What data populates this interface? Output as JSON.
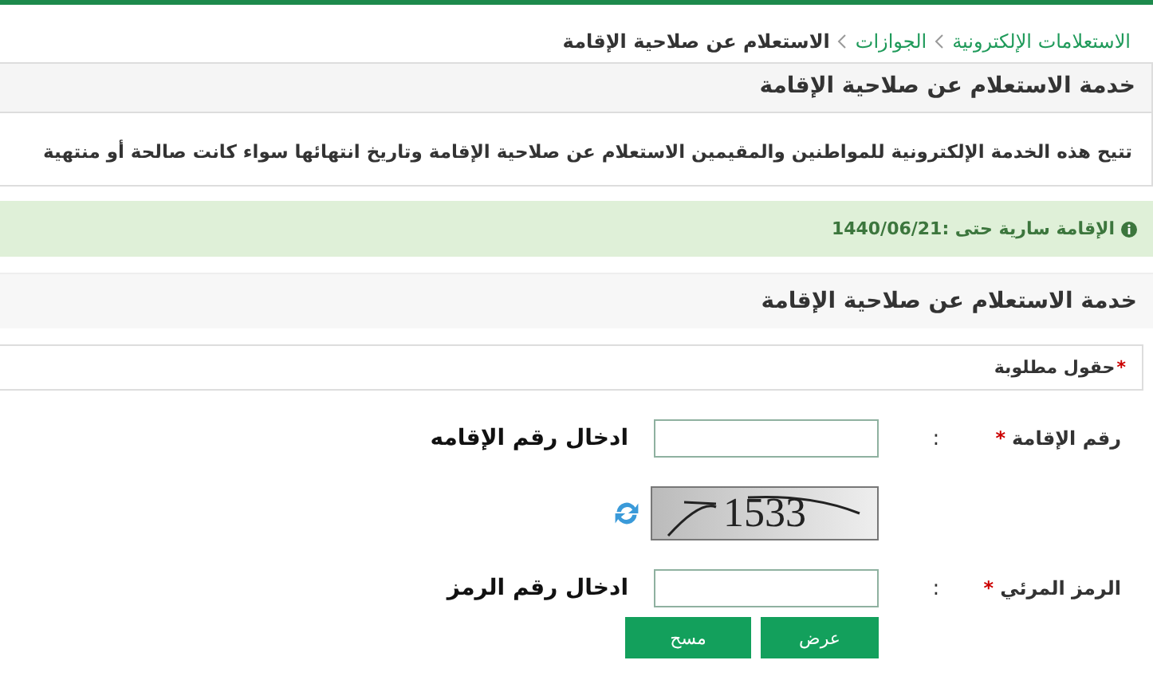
{
  "breadcrumb": [
    {
      "label": "الاستعلامات الإلكترونية",
      "kind": "link"
    },
    {
      "label": "الجوازات",
      "kind": "link"
    },
    {
      "label": "الاستعلام عن صلاحية الإقامة",
      "kind": "current"
    }
  ],
  "panel": {
    "title": "خدمة الاستعلام عن صلاحية الإقامة",
    "description": "تتيح هذه الخدمة الإلكترونية للمواطنين والمقيمين الاستعلام عن صلاحية الإقامة وتاريخ انتهائها سواء كانت صالحة أو منتهية"
  },
  "alert": {
    "text": "الإقامة سارية حتى :1440/06/21"
  },
  "form": {
    "title": "خدمة الاستعلام عن صلاحية الإقامة",
    "required_mark": "*",
    "required_note": "حقول مطلوبة",
    "fields": [
      {
        "kind": "input",
        "label": "رقم الإقامة",
        "required_mark": "*",
        "colon": ":",
        "annotation": "ادخال رقم الإقامه"
      },
      {
        "kind": "captcha",
        "code": "1533"
      },
      {
        "kind": "input",
        "label": "الرمز المرئي",
        "required_mark": "*",
        "colon": ":",
        "annotation": "ادخال رقم الرمز"
      }
    ],
    "buttons": [
      "عرض",
      "مسح"
    ]
  }
}
